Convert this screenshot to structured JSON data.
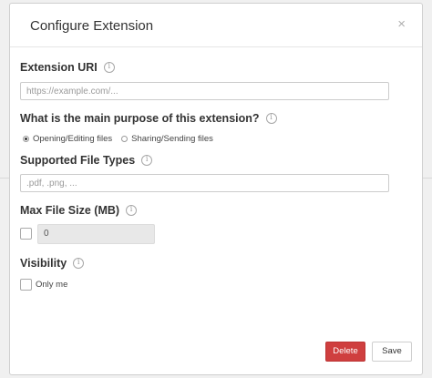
{
  "dialog": {
    "title": "Configure Extension",
    "close_glyph": "×"
  },
  "fields": {
    "uri": {
      "label": "Extension URI",
      "placeholder": "https://example.com/..."
    },
    "purpose": {
      "label": "What is the main purpose of this extension?",
      "options": [
        {
          "label": "Opening/Editing files",
          "selected": true
        },
        {
          "label": "Sharing/Sending files",
          "selected": false
        }
      ]
    },
    "file_types": {
      "label": "Supported File Types",
      "placeholder": ".pdf, .png, ..."
    },
    "max_size": {
      "label": "Max File Size (MB)",
      "value": "0",
      "enabled": false
    },
    "visibility": {
      "label": "Visibility",
      "option_label": "Only me",
      "checked": false
    }
  },
  "buttons": {
    "delete_label": "Delete",
    "save_label": "Save"
  },
  "colors": {
    "danger": "#cf3f3f",
    "border": "#cccccc"
  },
  "icons": [
    "close-icon",
    "info-icon",
    "radio-icon",
    "checkbox-icon"
  ]
}
